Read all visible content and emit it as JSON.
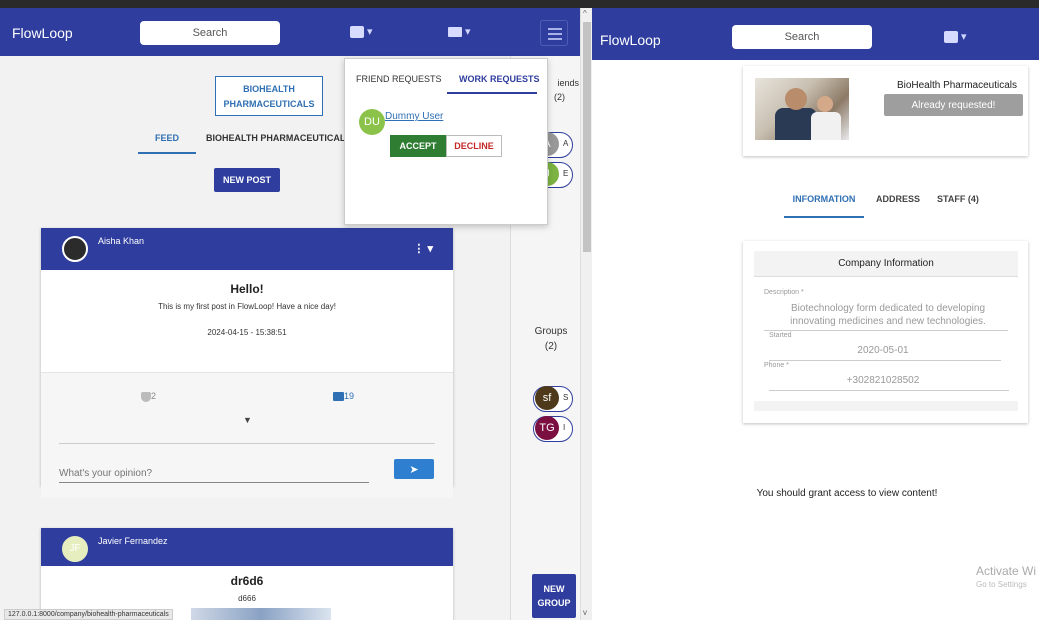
{
  "left": {
    "nav": {
      "brand": "FlowLoop",
      "search_placeholder": "Search"
    },
    "company_chip": "BIOHEALTH PHARMACEUTICALS",
    "tabs": [
      "FEED",
      "BIOHEALTH PHARMACEUTICALS"
    ],
    "new_post_label": "NEW POST",
    "posts": [
      {
        "author": "Aisha Khan",
        "title": "Hello!",
        "text": "This is my first post in FlowLoop! Have a nice day!",
        "date": "2024-04-15 - 15:38:51",
        "upvotes": "2",
        "comments": "19",
        "opinion_placeholder": "What's your opinion?"
      },
      {
        "author": "Javier Fernandez",
        "initials": "JF",
        "title": "dr6d6",
        "text": "d666"
      }
    ],
    "side": {
      "friends_label": "iends",
      "friends_count": "(2)",
      "groups_label": "Groups",
      "groups_count": "(2)",
      "friend_initials": [
        "A",
        "J"
      ],
      "friend_letters": [
        "A",
        "E"
      ],
      "group_initials": [
        "sf",
        "TG"
      ],
      "group_letters": [
        "S",
        "I"
      ],
      "new_group_label_1": "NEW",
      "new_group_label_2": "GROUP"
    },
    "status_url": "127.0.0.1:8000/company/biohealth-pharmaceuticals"
  },
  "popup": {
    "tab_friend": "FRIEND REQUESTS",
    "tab_work": "WORK REQUESTS",
    "user_initials": "DU",
    "user_name": "Dummy User",
    "accept_label": "ACCEPT",
    "decline_label": "DECLINE"
  },
  "right": {
    "nav": {
      "brand": "FlowLoop",
      "search_placeholder": "Search"
    },
    "company_name": "BioHealth Pharmaceuticals",
    "requested_label": "Already requested!",
    "tabs": [
      "INFORMATION",
      "ADDRESS",
      "STAFF (4)"
    ],
    "info_title": "Company Information",
    "fields": {
      "description_label": "Description *",
      "description_value": "Biotechnology form dedicated to developing innovating medicines and new technologies.",
      "started_label": "Started",
      "started_value": "2020-05-01",
      "phone_label": "Phone *",
      "phone_value": "+302821028502"
    },
    "grant_message": "You should grant access to view content!",
    "activate_title": "Activate Wi",
    "activate_sub": "Go to Settings"
  },
  "colors": {
    "nav": "#2f3e9e",
    "link": "#2f6fb3",
    "accept": "#2e7d32",
    "decline": "#c62828",
    "send": "#2f7fd0"
  }
}
